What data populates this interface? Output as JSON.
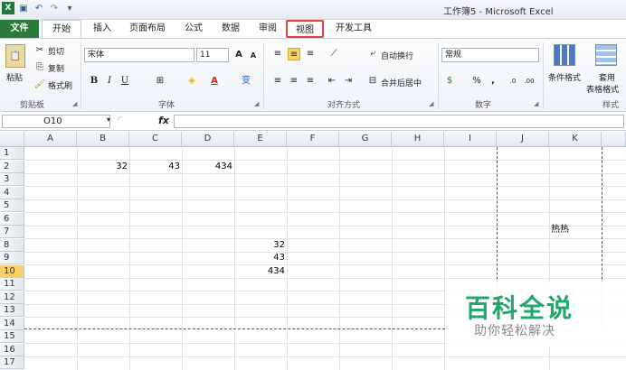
{
  "window": {
    "title": "工作簿5 - Microsoft Excel"
  },
  "qat": {
    "icons": [
      "excel-logo-icon",
      "save-icon",
      "undo-icon",
      "redo-icon",
      "customize-icon"
    ]
  },
  "tabs": [
    {
      "label": "文件"
    },
    {
      "label": "开始"
    },
    {
      "label": "插入"
    },
    {
      "label": "页面布局"
    },
    {
      "label": "公式"
    },
    {
      "label": "数据"
    },
    {
      "label": "审阅"
    },
    {
      "label": "视图"
    },
    {
      "label": "开发工具"
    }
  ],
  "highlight_color": "#e0443b",
  "ribbon": {
    "clipboard": {
      "paste": "粘贴",
      "cut": "剪切",
      "copy": "复制",
      "format_painter": "格式刷",
      "label": "剪贴板"
    },
    "font": {
      "name": "宋体",
      "size": "11",
      "bold": "B",
      "italic": "I",
      "underline": "U",
      "label": "字体",
      "grow": "A",
      "shrink": "A",
      "phonetic": "变"
    },
    "alignment": {
      "wrap": "自动换行",
      "merge": "合并后居中",
      "label": "对齐方式"
    },
    "number": {
      "format": "常规",
      "percent": "%",
      "comma": ",",
      "inc_dec": ".0",
      "dec_dec": ".00",
      "label": "数字"
    },
    "styles": {
      "conditional": "条件格式",
      "table_top": "套用",
      "table_bottom": "表格格式",
      "label": "样式"
    }
  },
  "formula_bar": {
    "name_box": "O10",
    "fx": "fx",
    "formula": ""
  },
  "columns": [
    "A",
    "B",
    "C",
    "D",
    "E",
    "F",
    "G",
    "H",
    "I",
    "J",
    "K"
  ],
  "rows": [
    "1",
    "2",
    "3",
    "4",
    "5",
    "6",
    "7",
    "8",
    "9",
    "10",
    "11",
    "12",
    "13",
    "14",
    "15",
    "16",
    "17"
  ],
  "selected_row": "10",
  "cells": {
    "B2": "32",
    "C2": "43",
    "D2": "434",
    "E8": "32",
    "E9": "43",
    "E10": "434",
    "K7": "热热"
  },
  "watermark": {
    "title": "百科全说",
    "subtitle": "助你轻松解决"
  }
}
